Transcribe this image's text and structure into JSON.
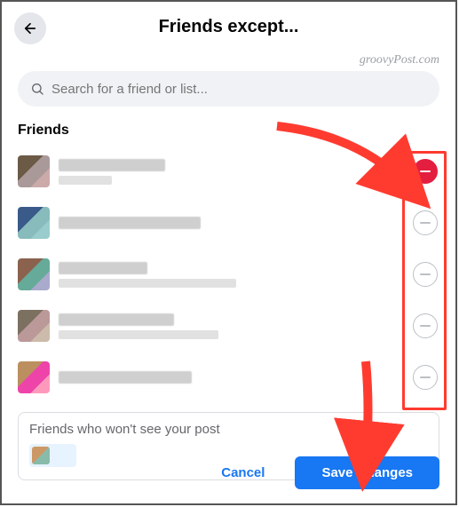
{
  "header": {
    "title": "Friends except..."
  },
  "watermark": "groovyPost.com",
  "search": {
    "placeholder": "Search for a friend or list..."
  },
  "section_label": "Friends",
  "friends": [
    {
      "name_width": 120,
      "sub_width": 60,
      "excluded": true
    },
    {
      "name_width": 160,
      "sub_width": 0,
      "excluded": false
    },
    {
      "name_width": 100,
      "sub_width": 200,
      "excluded": false
    },
    {
      "name_width": 130,
      "sub_width": 180,
      "excluded": false
    },
    {
      "name_width": 150,
      "sub_width": 0,
      "excluded": false
    }
  ],
  "excluded_box": {
    "label": "Friends who won't see your post"
  },
  "footer": {
    "cancel": "Cancel",
    "save": "Save Changes"
  }
}
